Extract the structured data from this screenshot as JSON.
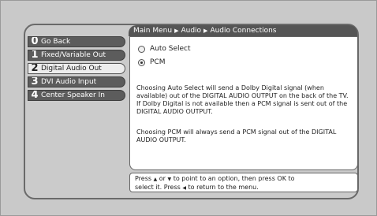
{
  "breadcrumb": {
    "items": [
      "Main Menu",
      "Audio",
      "Audio Connections"
    ],
    "separator": "▶"
  },
  "menu": {
    "items": [
      {
        "num": "0",
        "label": "Go Back"
      },
      {
        "num": "1",
        "label": "Fixed/Variable Out"
      },
      {
        "num": "2",
        "label": "Digital Audio Out"
      },
      {
        "num": "3",
        "label": "DVI Audio Input"
      },
      {
        "num": "4",
        "label": "Center Speaker In"
      }
    ],
    "selected_index": 2
  },
  "options": [
    {
      "label": "Auto Select"
    },
    {
      "label": "PCM"
    }
  ],
  "description": {
    "para1": "Choosing Auto Select will send a Dolby Digital signal (when available) out of the DIGITAL AUDIO OUTPUT on the back of the TV. If Dolby Digital is not available then a PCM signal is sent out of the DIGITAL AUDIO OUTPUT.",
    "para2": "Choosing PCM will always send a PCM signal out of the DIGITAL AUDIO OUTPUT."
  },
  "help": {
    "part1": "Press",
    "up_glyph": "▲",
    "part2": "or",
    "down_glyph": "▼",
    "part3": "to point to an option, then press OK to",
    "part4": "select it. Press",
    "left_glyph": "◀",
    "part5": "to return to the menu."
  },
  "colors": {
    "menu_bg": "#5c5c5c",
    "menu_selected_bg": "#ececec",
    "breadcrumb_bg": "#555555",
    "content_bg": "#ffffff"
  }
}
